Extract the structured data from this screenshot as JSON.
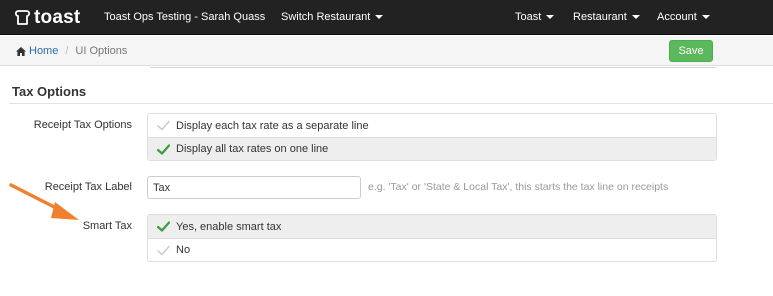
{
  "brand": {
    "name": "toast"
  },
  "navbar": {
    "account_title": "Toast Ops Testing - Sarah Quass",
    "switch_restaurant": "Switch Restaurant",
    "toast_menu": "Toast",
    "restaurant_menu": "Restaurant",
    "account_menu": "Account"
  },
  "breadcrumb": {
    "home": "Home",
    "current": "UI Options"
  },
  "toolbar": {
    "save_label": "Save"
  },
  "section": {
    "title": "Tax Options"
  },
  "receipt_tax_options": {
    "label": "Receipt Tax Options",
    "options": [
      {
        "label": "Display each tax rate as a separate line",
        "selected": false
      },
      {
        "label": "Display all tax rates on one line",
        "selected": true
      }
    ]
  },
  "receipt_tax_label": {
    "label": "Receipt Tax Label",
    "value": "Tax",
    "help": "e.g. 'Tax' or 'State & Local Tax', this starts the tax line on receipts"
  },
  "smart_tax": {
    "label": "Smart Tax",
    "options": [
      {
        "label": "Yes, enable smart tax",
        "selected": true
      },
      {
        "label": "No",
        "selected": false
      }
    ]
  },
  "colors": {
    "navbar_bg": "#222222",
    "link": "#2a6fb3",
    "save_button": "#5cb85c",
    "check_selected": "#3c9d3c",
    "check_unselected": "#cccccc",
    "annotation_arrow": "#f07f2e"
  },
  "icons": {
    "brand": "toast-logo-icon",
    "home": "home-icon",
    "check": "checkmark-icon",
    "annotation": "orange-arrow-icon"
  }
}
